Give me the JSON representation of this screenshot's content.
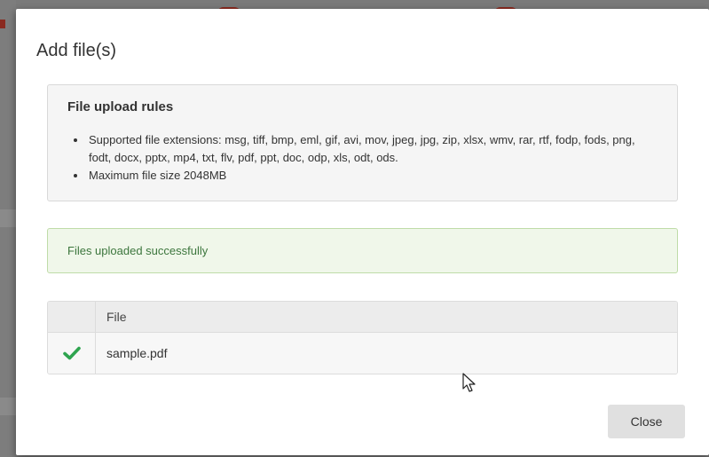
{
  "dialog": {
    "title": "Add file(s)"
  },
  "rules": {
    "heading": "File upload rules",
    "items": [
      "Supported file extensions: msg, tiff, bmp, eml, gif, avi, mov, jpeg, jpg, zip, xlsx, wmv, rar, rtf, fodp, fods, png, fodt, docx, pptx, mp4, txt, flv, pdf, ppt, doc, odp, xls, odt, ods.",
      "Maximum file size 2048MB"
    ]
  },
  "alert": {
    "message": "Files uploaded successfully"
  },
  "table": {
    "column_status": "",
    "column_file": "File",
    "rows": [
      {
        "status_icon": "check-icon",
        "name": "sample.pdf"
      }
    ]
  },
  "buttons": {
    "close_label": "Close"
  },
  "colors": {
    "success_text": "#3c763d",
    "success_bg": "#f0f7ea",
    "check_green": "#2ea44f"
  }
}
